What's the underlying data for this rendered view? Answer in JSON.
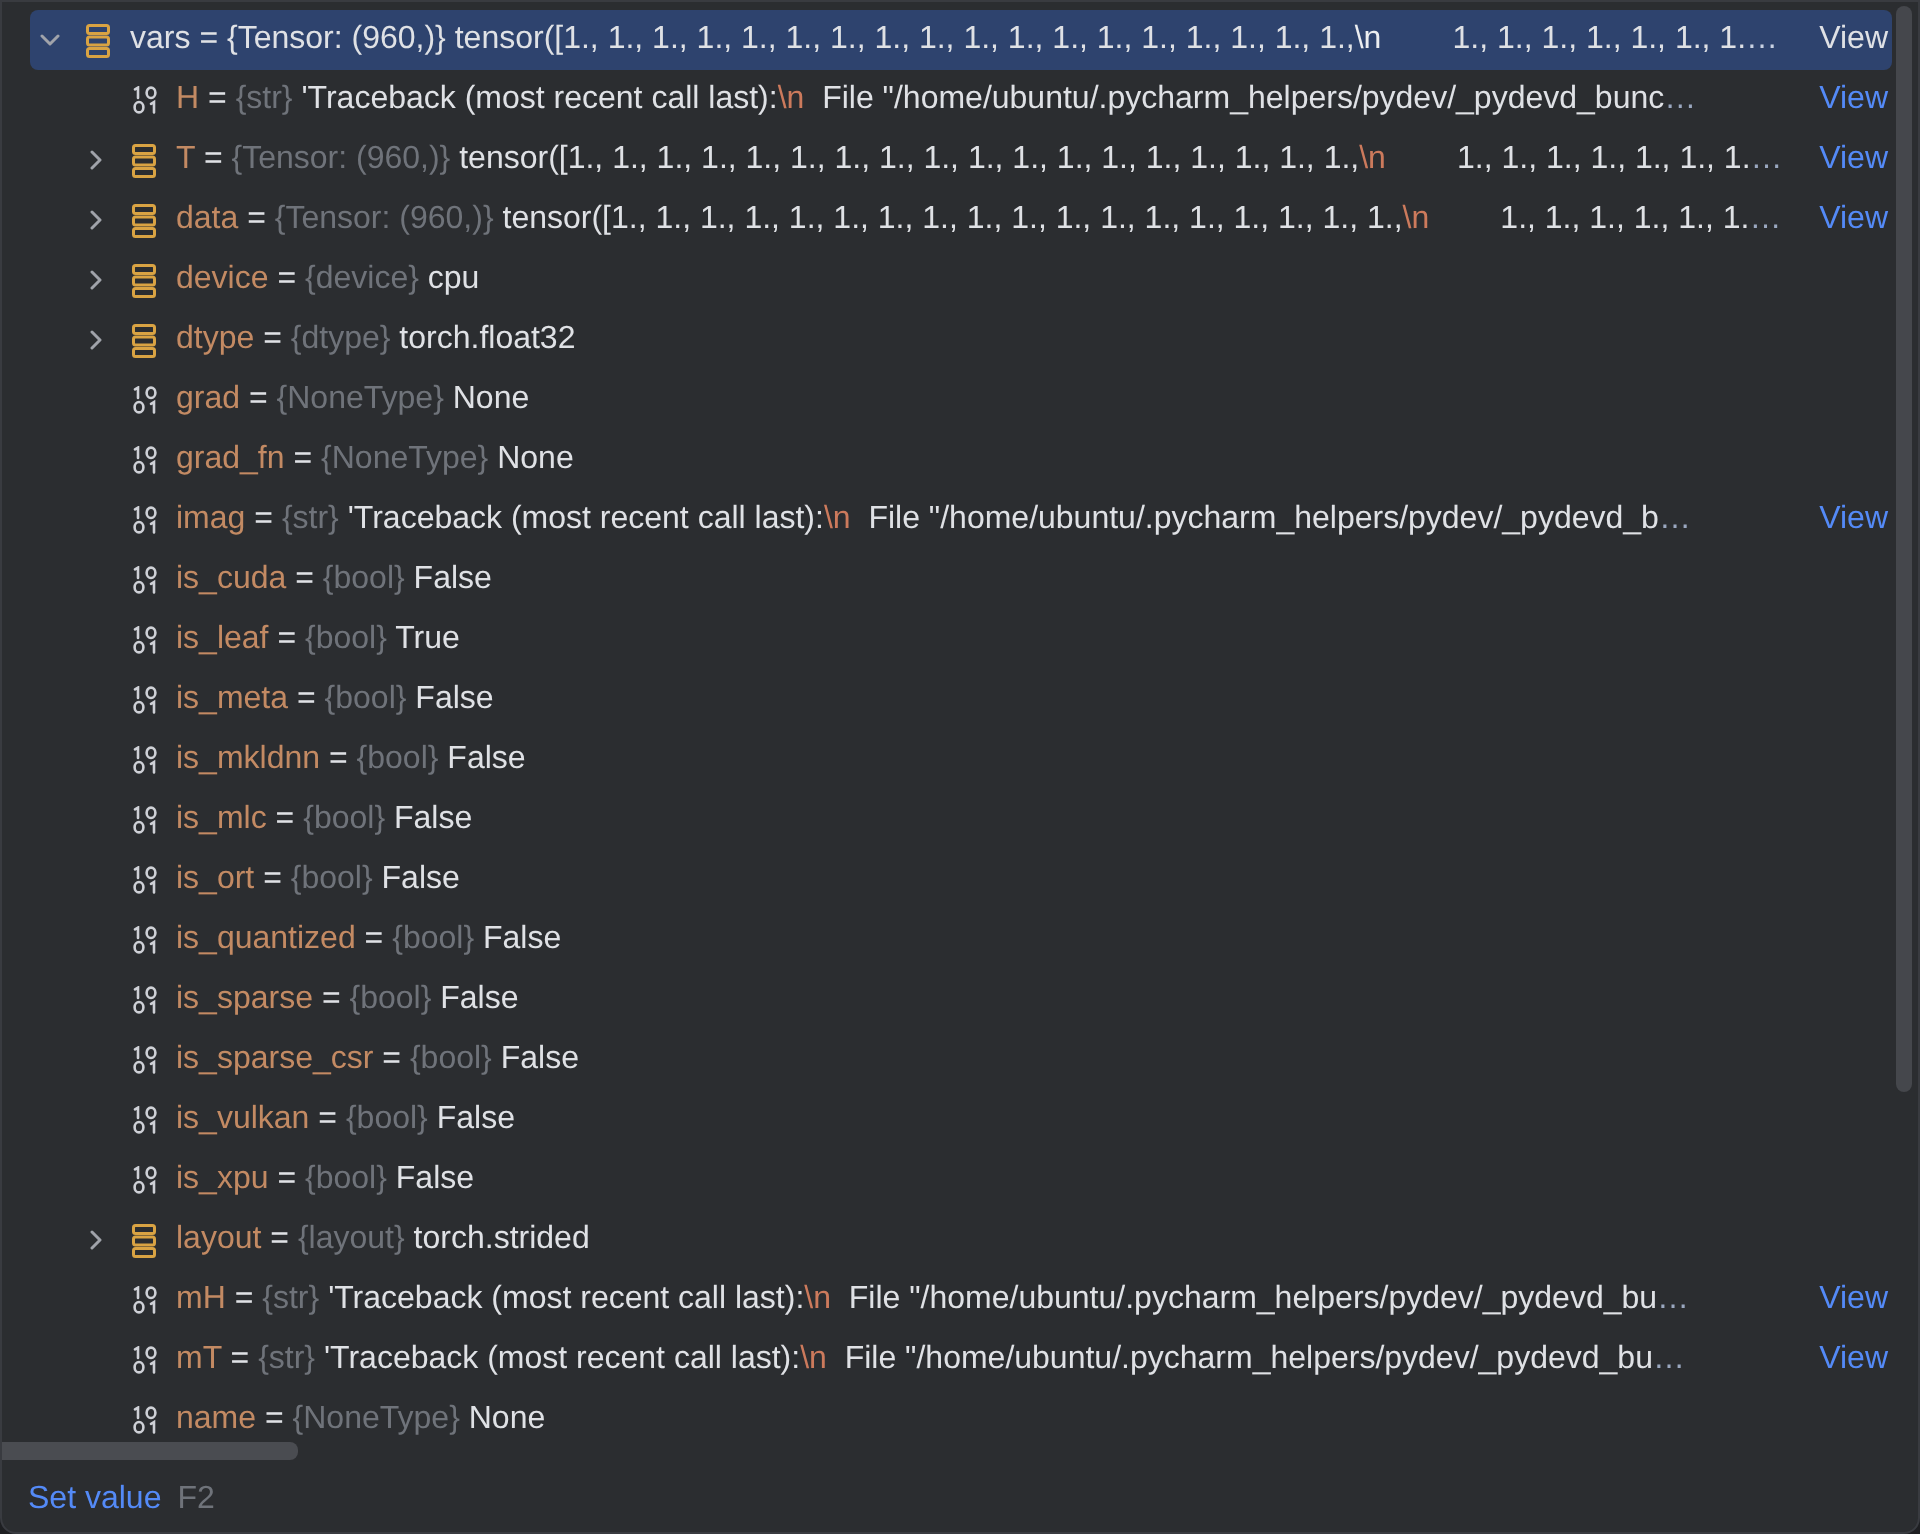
{
  "tree": [
    {
      "name": "vars",
      "sep": "=",
      "type": "{Tensor: (960,)}",
      "value": [
        {
          "text": "tensor([1., 1., 1., 1., 1., 1., 1., 1., 1., 1., 1., 1., 1., 1., 1., 1., 1., 1.,",
          "kind": "plain"
        },
        {
          "text": "\\n",
          "kind": "escape"
        },
        {
          "text": "        1., 1., 1., 1., 1., 1., 1.",
          "kind": "plain"
        },
        {
          "text": "…",
          "kind": "ellipsis"
        }
      ],
      "kind": "object",
      "expanded": true,
      "selected": true,
      "view": "View",
      "children": [
        {
          "name": "H",
          "sep": "=",
          "type": "{str}",
          "value": [
            {
              "text": "'Traceback (most recent call last):",
              "kind": "plain"
            },
            {
              "text": "\\n",
              "kind": "escape"
            },
            {
              "text": "  File \"/home/ubuntu/.pycharm_helpers/pydev/_pydevd_bunc",
              "kind": "plain"
            },
            {
              "text": "…",
              "kind": "ellipsis"
            }
          ],
          "kind": "primitive",
          "selected": false,
          "view": "View"
        },
        {
          "name": "T",
          "sep": "=",
          "type": "{Tensor: (960,)}",
          "value": [
            {
              "text": "tensor([1., 1., 1., 1., 1., 1., 1., 1., 1., 1., 1., 1., 1., 1., 1., 1., 1., 1.,",
              "kind": "plain"
            },
            {
              "text": "\\n",
              "kind": "escape"
            },
            {
              "text": "        1., 1., 1., 1., 1., 1., 1.",
              "kind": "plain"
            },
            {
              "text": "…",
              "kind": "ellipsis"
            }
          ],
          "kind": "object",
          "expanded": false,
          "selected": false,
          "view": "View"
        },
        {
          "name": "data",
          "sep": "=",
          "type": "{Tensor: (960,)}",
          "value": [
            {
              "text": "tensor([1., 1., 1., 1., 1., 1., 1., 1., 1., 1., 1., 1., 1., 1., 1., 1., 1., 1.,",
              "kind": "plain"
            },
            {
              "text": "\\n",
              "kind": "escape"
            },
            {
              "text": "        1., 1., 1., 1., 1., 1.",
              "kind": "plain"
            },
            {
              "text": "…",
              "kind": "ellipsis"
            }
          ],
          "kind": "object",
          "expanded": false,
          "selected": false,
          "view": "View"
        },
        {
          "name": "device",
          "sep": "=",
          "type": "{device}",
          "value": "cpu",
          "kind": "object",
          "expanded": false,
          "selected": false
        },
        {
          "name": "dtype",
          "sep": "=",
          "type": "{dtype}",
          "value": "torch.float32",
          "kind": "object",
          "expanded": false,
          "selected": false
        },
        {
          "name": "grad",
          "sep": "=",
          "type": "{NoneType}",
          "value": "None",
          "kind": "primitive",
          "selected": false
        },
        {
          "name": "grad_fn",
          "sep": "=",
          "type": "{NoneType}",
          "value": "None",
          "kind": "primitive",
          "selected": false
        },
        {
          "name": "imag",
          "sep": "=",
          "type": "{str}",
          "value": [
            {
              "text": "'Traceback (most recent call last):",
              "kind": "plain"
            },
            {
              "text": "\\n",
              "kind": "escape"
            },
            {
              "text": "  File \"/home/ubuntu/.pycharm_helpers/pydev/_pydevd_b",
              "kind": "plain"
            },
            {
              "text": "…",
              "kind": "ellipsis"
            }
          ],
          "kind": "primitive",
          "selected": false,
          "view": "View"
        },
        {
          "name": "is_cuda",
          "sep": "=",
          "type": "{bool}",
          "value": "False",
          "kind": "primitive",
          "selected": false
        },
        {
          "name": "is_leaf",
          "sep": "=",
          "type": "{bool}",
          "value": "True",
          "kind": "primitive",
          "selected": false
        },
        {
          "name": "is_meta",
          "sep": "=",
          "type": "{bool}",
          "value": "False",
          "kind": "primitive",
          "selected": false
        },
        {
          "name": "is_mkldnn",
          "sep": "=",
          "type": "{bool}",
          "value": "False",
          "kind": "primitive",
          "selected": false
        },
        {
          "name": "is_mlc",
          "sep": "=",
          "type": "{bool}",
          "value": "False",
          "kind": "primitive",
          "selected": false
        },
        {
          "name": "is_ort",
          "sep": "=",
          "type": "{bool}",
          "value": "False",
          "kind": "primitive",
          "selected": false
        },
        {
          "name": "is_quantized",
          "sep": "=",
          "type": "{bool}",
          "value": "False",
          "kind": "primitive",
          "selected": false
        },
        {
          "name": "is_sparse",
          "sep": "=",
          "type": "{bool}",
          "value": "False",
          "kind": "primitive",
          "selected": false
        },
        {
          "name": "is_sparse_csr",
          "sep": "=",
          "type": "{bool}",
          "value": "False",
          "kind": "primitive",
          "selected": false
        },
        {
          "name": "is_vulkan",
          "sep": "=",
          "type": "{bool}",
          "value": "False",
          "kind": "primitive",
          "selected": false
        },
        {
          "name": "is_xpu",
          "sep": "=",
          "type": "{bool}",
          "value": "False",
          "kind": "primitive",
          "selected": false
        },
        {
          "name": "layout",
          "sep": "=",
          "type": "{layout}",
          "value": "torch.strided",
          "kind": "object",
          "expanded": false,
          "selected": false
        },
        {
          "name": "mH",
          "sep": "=",
          "type": "{str}",
          "value": [
            {
              "text": "'Traceback (most recent call last):",
              "kind": "plain"
            },
            {
              "text": "\\n",
              "kind": "escape"
            },
            {
              "text": "  File \"/home/ubuntu/.pycharm_helpers/pydev/_pydevd_bu",
              "kind": "plain"
            },
            {
              "text": "…",
              "kind": "ellipsis"
            }
          ],
          "kind": "primitive",
          "selected": false,
          "view": "View"
        },
        {
          "name": "mT",
          "sep": "=",
          "type": "{str}",
          "value": [
            {
              "text": "'Traceback (most recent call last):",
              "kind": "plain"
            },
            {
              "text": "\\n",
              "kind": "escape"
            },
            {
              "text": "  File \"/home/ubuntu/.pycharm_helpers/pydev/_pydevd_bu",
              "kind": "plain"
            },
            {
              "text": "…",
              "kind": "ellipsis"
            }
          ],
          "kind": "primitive",
          "selected": false,
          "view": "View"
        },
        {
          "name": "name",
          "sep": "=",
          "type": "{NoneType}",
          "value": "None",
          "kind": "primitive",
          "selected": false
        }
      ]
    }
  ],
  "status_bar": {
    "action": "Set value",
    "shortcut": "F2"
  }
}
